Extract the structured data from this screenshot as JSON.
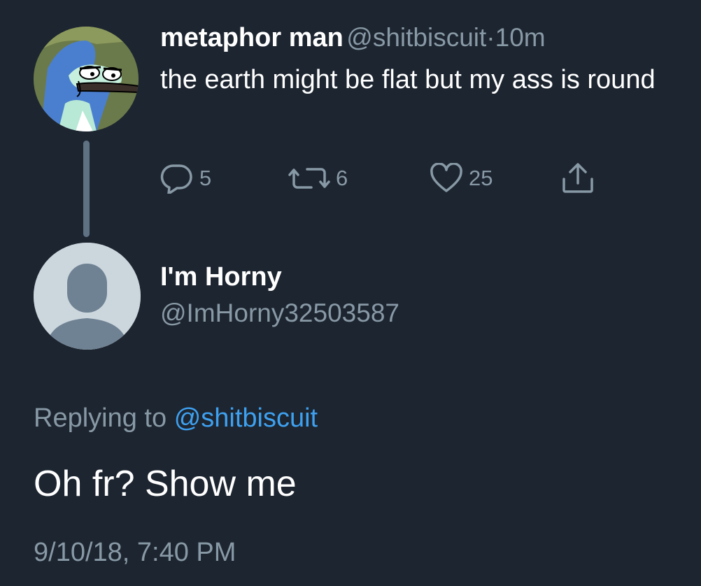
{
  "parent_tweet": {
    "display_name": "metaphor man",
    "handle": "@shitbiscuit",
    "separator": "·",
    "time": "10m",
    "text": "the earth might be flat but my ass is round",
    "actions": {
      "reply_count": "5",
      "retweet_count": "6",
      "like_count": "25"
    },
    "avatar_icon": "cartoon-bird-avatar"
  },
  "reply_tweet": {
    "display_name": "I'm Horny",
    "handle": "@ImHorny32503587",
    "replying_prefix": "Replying to",
    "replying_to": "@shitbiscuit",
    "text": "Oh fr? Show me",
    "timestamp": "9/10/18, 7:40 PM",
    "avatar_icon": "default-profile-avatar"
  },
  "colors": {
    "background": "#1d2530",
    "primary_text": "#ffffff",
    "secondary_text": "#8899a6",
    "link": "#3ea1f0",
    "thread_line": "#5f7284"
  }
}
